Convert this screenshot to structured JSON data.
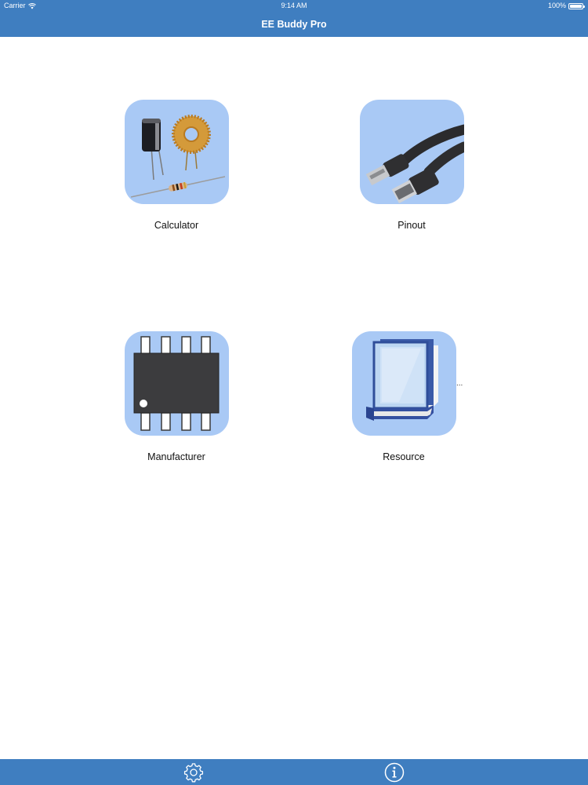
{
  "status_bar": {
    "carrier": "Carrier",
    "time": "9:14 AM",
    "battery": "100%"
  },
  "nav": {
    "title": "EE Buddy Pro"
  },
  "menu": {
    "items": [
      {
        "label": "Calculator",
        "icon": "components-icon"
      },
      {
        "label": "Pinout",
        "icon": "usb-cable-icon"
      },
      {
        "label": "Manufacturer",
        "icon": "ic-chip-icon"
      },
      {
        "label": "Resource",
        "icon": "book-icon"
      }
    ],
    "overflow_text": "..."
  },
  "tab_bar": {
    "items": [
      {
        "icon": "gear-icon"
      },
      {
        "icon": "info-icon"
      }
    ]
  },
  "colors": {
    "bar": "#3f7ec0",
    "tile_background": "#a9c9f5"
  }
}
